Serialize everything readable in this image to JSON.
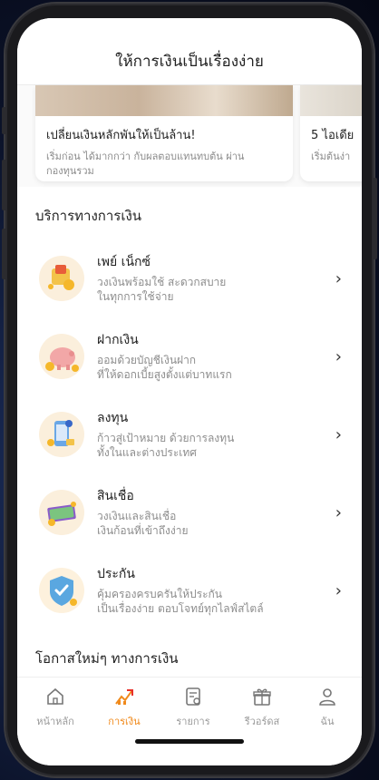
{
  "header": {
    "title": "ให้การเงินเป็นเรื่องง่าย"
  },
  "cards": [
    {
      "title": "เปลี่ยนเงินหลักพันให้เป็นล้าน!",
      "desc_line1": "เริ่มก่อน ได้มากกว่า กับผลตอบแทนทบต้น ผ่าน",
      "desc_line2": "กองทุนรวม"
    },
    {
      "title": "5 ไอเดีย",
      "desc_line1": "เริ่มต้นง่า",
      "desc_line2": ""
    }
  ],
  "services_title": "บริการทางการเงิน",
  "services": [
    {
      "name": "เพย์ เน็กซ์",
      "line1": "วงเงินพร้อมใช้ สะดวกสบาย",
      "line2": "ในทุกการใช้จ่าย",
      "icon": "wallet-icon"
    },
    {
      "name": "ฝากเงิน",
      "line1": "ออมด้วยบัญชีเงินฝาก",
      "line2": "ที่ให้ดอกเบี้ยสูงตั้งแต่บาทแรก",
      "icon": "piggy-bank-icon"
    },
    {
      "name": "ลงทุน",
      "line1": "ก้าวสู่เป้าหมาย ด้วยการลงทุน",
      "line2": "ทั้งในและต่างประเทศ",
      "icon": "invest-phone-icon"
    },
    {
      "name": "สินเชื่อ",
      "line1": "วงเงินและสินเชื่อ",
      "line2": "เงินก้อนที่เข้าถึงง่าย",
      "icon": "cash-stack-icon"
    },
    {
      "name": "ประกัน",
      "line1": "คุ้มครองครบครันให้ประกัน",
      "line2": "เป็นเรื่องง่าย ตอบโจทย์ทุกไลฟ์สไตล์",
      "icon": "shield-check-icon"
    }
  ],
  "opportunities_title": "โอกาสใหม่ๆ ทางการเงิน",
  "tabs": [
    {
      "label": "หน้าหลัก",
      "icon": "home-icon"
    },
    {
      "label": "การเงิน",
      "icon": "finance-icon"
    },
    {
      "label": "รายการ",
      "icon": "receipt-icon"
    },
    {
      "label": "รีวอร์ดส",
      "icon": "gift-icon"
    },
    {
      "label": "ฉัน",
      "icon": "person-icon"
    }
  ],
  "colors": {
    "accent": "#f08a1c",
    "muted": "#9a9a9a"
  }
}
